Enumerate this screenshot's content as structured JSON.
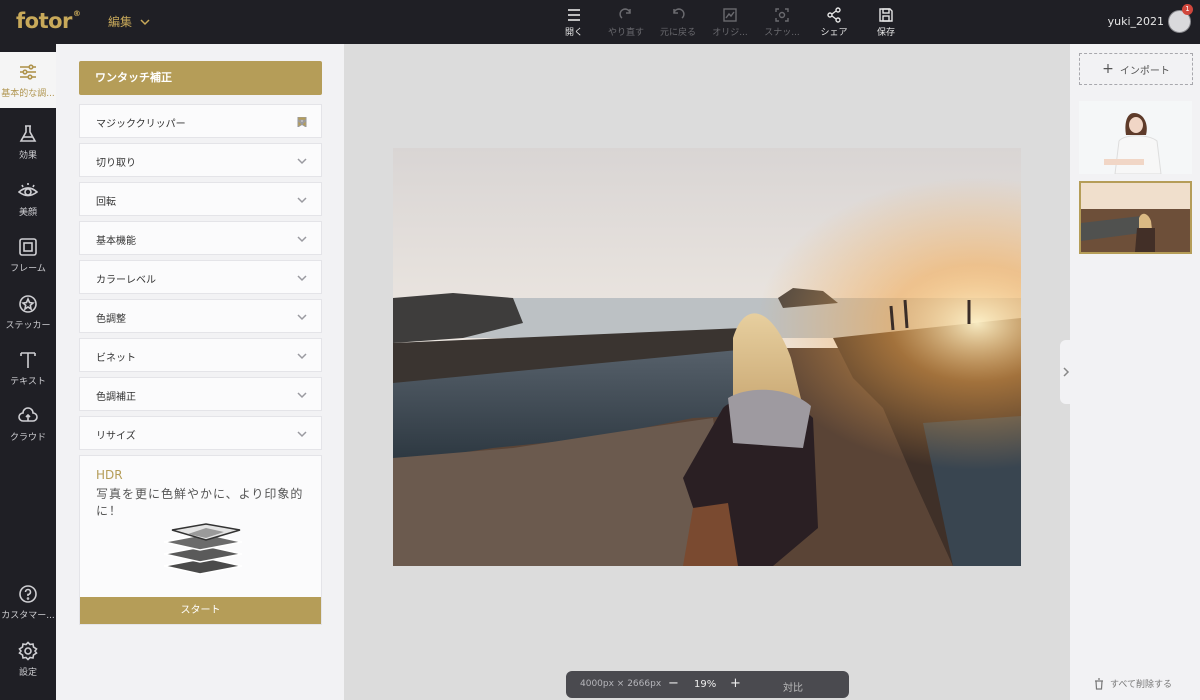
{
  "app": {
    "logo": "fotor",
    "registered": "®",
    "mode_menu": "編集"
  },
  "toolbar": {
    "items": [
      {
        "label": "開く",
        "icon": "menu-icon",
        "enabled": true
      },
      {
        "label": "やり直す",
        "icon": "redo-icon",
        "enabled": false
      },
      {
        "label": "元に戻る",
        "icon": "undo-icon",
        "enabled": false
      },
      {
        "label": "オリジ...",
        "icon": "original-icon",
        "enabled": false
      },
      {
        "label": "スナッ...",
        "icon": "snapshot-icon",
        "enabled": false
      },
      {
        "label": "シェア",
        "icon": "share-icon",
        "enabled": true
      },
      {
        "label": "保存",
        "icon": "save-icon",
        "enabled": true
      }
    ]
  },
  "user": {
    "name": "yuki_2021",
    "notifications": "1"
  },
  "leftnav": {
    "items": [
      {
        "label": "基本的な調...",
        "icon": "sliders-icon"
      },
      {
        "label": "効果",
        "icon": "flask-icon"
      },
      {
        "label": "美顔",
        "icon": "eye-icon"
      },
      {
        "label": "フレーム",
        "icon": "frame-icon"
      },
      {
        "label": "ステッカー",
        "icon": "sticker-icon"
      },
      {
        "label": "テキスト",
        "icon": "text-icon"
      },
      {
        "label": "クラウド",
        "icon": "cloud-icon"
      },
      {
        "label": "カスタマー...",
        "icon": "help-icon"
      },
      {
        "label": "設定",
        "icon": "gear-icon"
      }
    ]
  },
  "panel": {
    "oneclick": "ワンタッチ補正",
    "sections": [
      "マジッククリッパー",
      "切り取り",
      "回転",
      "基本機能",
      "カラーレベル",
      "色調整",
      "ビネット",
      "色調補正",
      "リサイズ"
    ],
    "hdr": {
      "title": "HDR",
      "desc": "写真を更に色鮮やかに、より印象的に！",
      "button": "スタート"
    }
  },
  "canvas": {
    "dimensions": "4000px × 2666px",
    "zoom_out": "−",
    "zoom": "19%",
    "zoom_in": "+",
    "compare": "対比"
  },
  "right": {
    "import": "インポート",
    "import_plus": "+",
    "delete_all": "すべて削除する"
  },
  "colors": {
    "accent": "#b59d58",
    "dark": "#1f1f25",
    "panel": "#f2f2f4",
    "canvas": "#dcdcdc"
  }
}
